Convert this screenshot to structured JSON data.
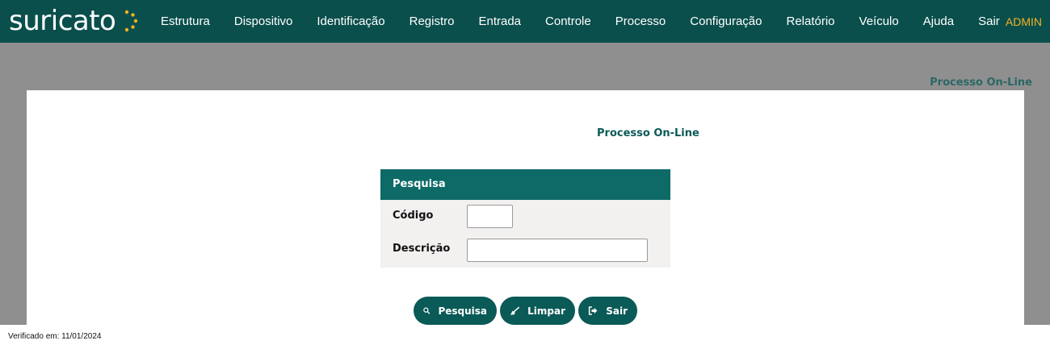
{
  "app": {
    "logo_text": "suricato",
    "accent_color": "#f4b120",
    "brand_color": "#0a4f4c"
  },
  "nav": {
    "items": [
      {
        "label": "Estrutura"
      },
      {
        "label": "Dispositivo"
      },
      {
        "label": "Identificação"
      },
      {
        "label": "Registro"
      },
      {
        "label": "Entrada"
      },
      {
        "label": "Controle"
      },
      {
        "label": "Processo"
      },
      {
        "label": "Configuração"
      },
      {
        "label": "Relatório"
      },
      {
        "label": "Veículo"
      },
      {
        "label": "Ajuda"
      },
      {
        "label": "Sair"
      }
    ],
    "user": "ADMIN"
  },
  "page": {
    "heading": "Processo On-Line",
    "panel_title": "Processo On-Line"
  },
  "search": {
    "header": "Pesquisa",
    "codigo_label": "Código",
    "codigo_value": "",
    "descricao_label": "Descrição",
    "descricao_value": ""
  },
  "buttons": {
    "pesquisa": {
      "label": "Pesquisa",
      "icon": "search-icon"
    },
    "limpar": {
      "label": "Limpar",
      "icon": "broom-icon"
    },
    "sair": {
      "label": "Sair",
      "icon": "sign-out-icon"
    }
  },
  "footer": {
    "verified": "Verificado em: 11/01/2024"
  }
}
